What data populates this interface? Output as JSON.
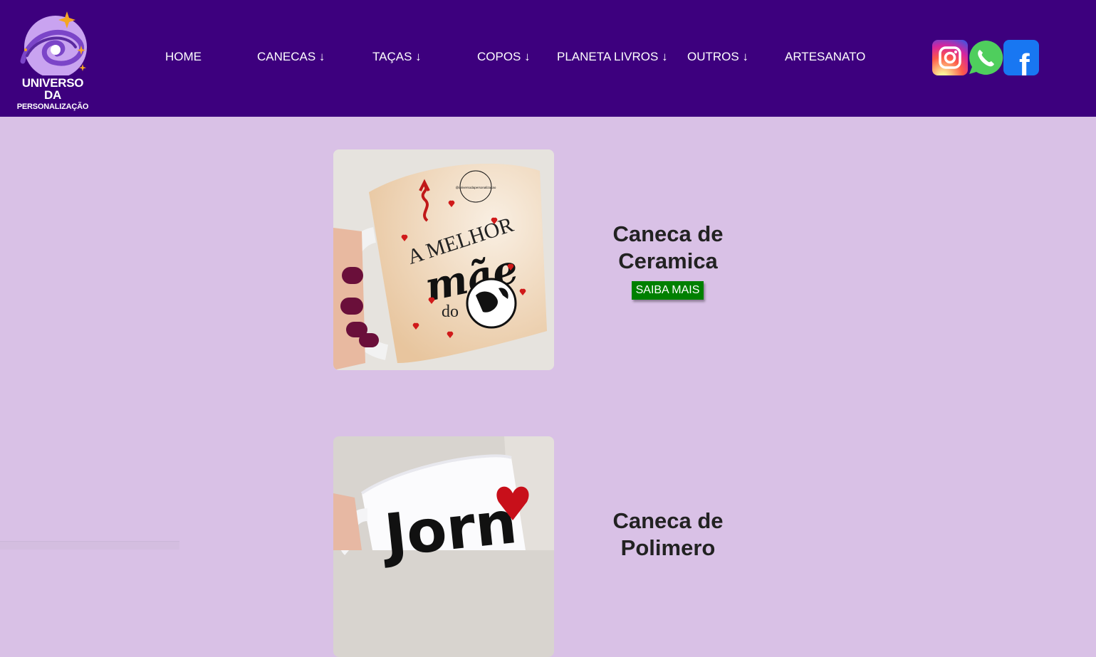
{
  "brand": {
    "line1": "UNIVERSO DA",
    "line2": "PERSONALIZAÇÃO"
  },
  "nav": {
    "home": "HOME",
    "canecas": "CANECAS ↓",
    "tacas": "TAÇAS ↓",
    "copos": "COPOS ↓",
    "planeta": "PLANETA LIVROS ↓",
    "outros": "OUTROS ↓",
    "artesanato": "ARTESANATO"
  },
  "social": {
    "icons": [
      "instagram-icon",
      "whatsapp-icon",
      "facebook-icon"
    ],
    "facebook_glyph": "f"
  },
  "products": [
    {
      "title_line1": "Caneca de",
      "title_line2": "Ceramica",
      "button": "SAIBA MAIS",
      "mug_text_1": "A MELHOR",
      "mug_text_2": "mãe",
      "mug_text_3": "do",
      "mug_stamp": "@universodapersonalizacao"
    },
    {
      "title_line1": "Caneca de",
      "title_line2": "Polimero",
      "mug_text": "Jorn"
    }
  ],
  "colors": {
    "header": "#3d007e",
    "background": "#d9c1e6",
    "button": "#008000"
  }
}
